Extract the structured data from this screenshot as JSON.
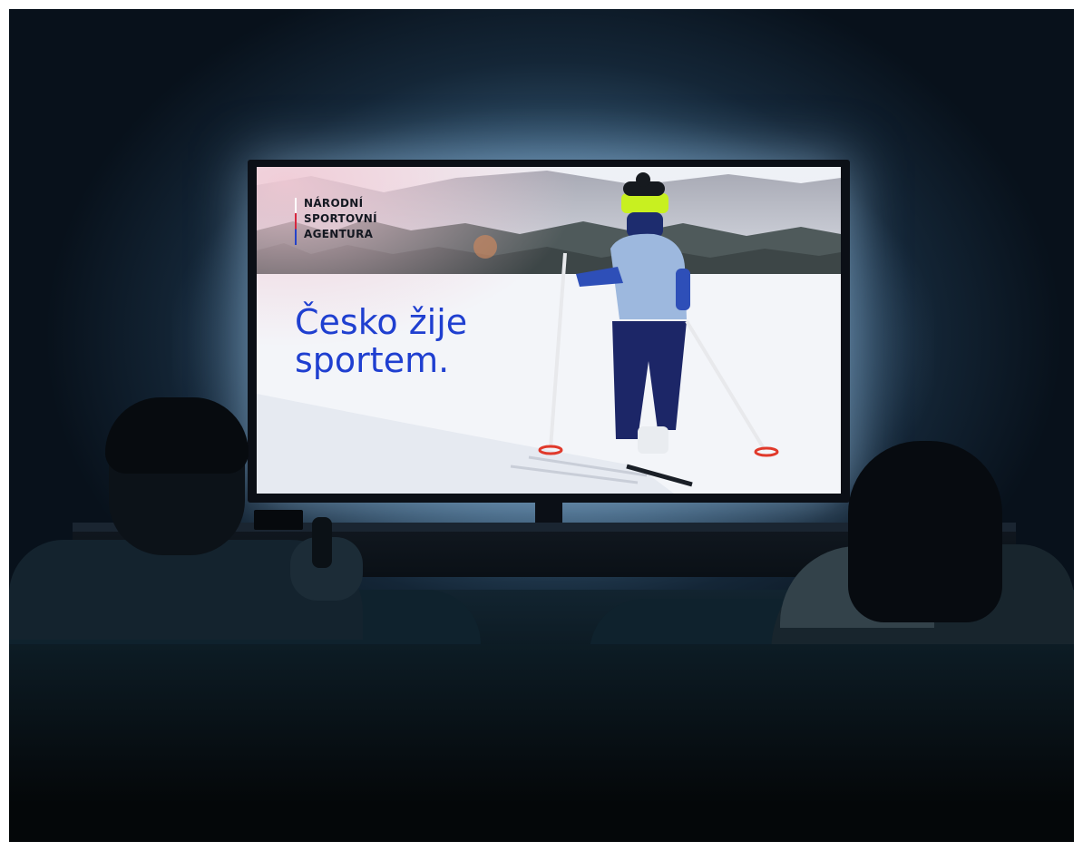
{
  "screen": {
    "wordmark": {
      "line1": "NÁRODNÍ",
      "line2": "SPORTOVNÍ",
      "line3": "AGENTURA"
    },
    "slogan": {
      "line1": "Česko žije",
      "line2": "sportem."
    }
  },
  "colors": {
    "accent_blue": "#1f3fd0",
    "accent_red": "#d7263d",
    "ambient_glow": "#7ea3c2"
  }
}
